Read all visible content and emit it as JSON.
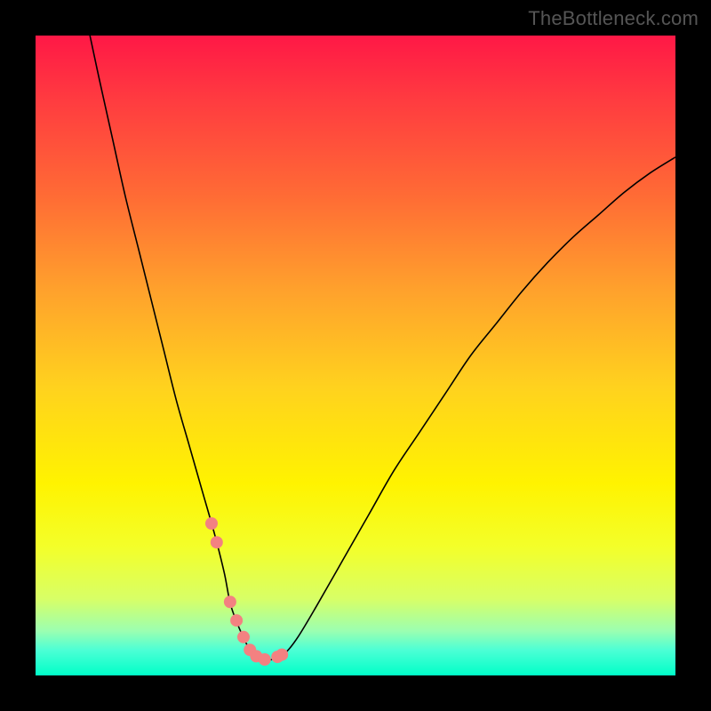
{
  "watermark": "TheBottleneck.com",
  "colors": {
    "page_bg": "#000000",
    "gradient": [
      "#ff1846",
      "#ff3b40",
      "#ff6b35",
      "#ffa22c",
      "#ffd21e",
      "#fff300",
      "#f3ff2a",
      "#d8ff66",
      "#9cffb0",
      "#4dffd5",
      "#00ffc8"
    ],
    "curve_stroke": "#000000",
    "bead_fill": "#f38181"
  },
  "chart_data": {
    "type": "line",
    "title": "",
    "xlabel": "",
    "ylabel": "",
    "xlim": [
      0,
      100
    ],
    "ylim": [
      0,
      100
    ],
    "x": [
      8.5,
      10,
      12,
      14,
      16,
      18,
      20,
      22,
      24,
      26,
      28,
      29.5,
      30.5,
      32,
      33.5,
      35,
      37,
      39,
      41,
      44,
      48,
      52,
      56,
      60,
      64,
      68,
      72,
      76,
      80,
      84,
      88,
      92,
      96,
      100
    ],
    "values": [
      100,
      93,
      84,
      75,
      67,
      59,
      51,
      43,
      36,
      29,
      22,
      16,
      11,
      7,
      4,
      2.5,
      2.5,
      3.5,
      6,
      11,
      18,
      25,
      32,
      38,
      44,
      50,
      55,
      60,
      64.5,
      68.5,
      72,
      75.5,
      78.5,
      81
    ],
    "flat_min_range_x": [
      33,
      37
    ],
    "bead_points_x": [
      27.5,
      28.3,
      30.4,
      31.4,
      32.5,
      33.5,
      34.5,
      35.8,
      37.8,
      38.5
    ]
  }
}
